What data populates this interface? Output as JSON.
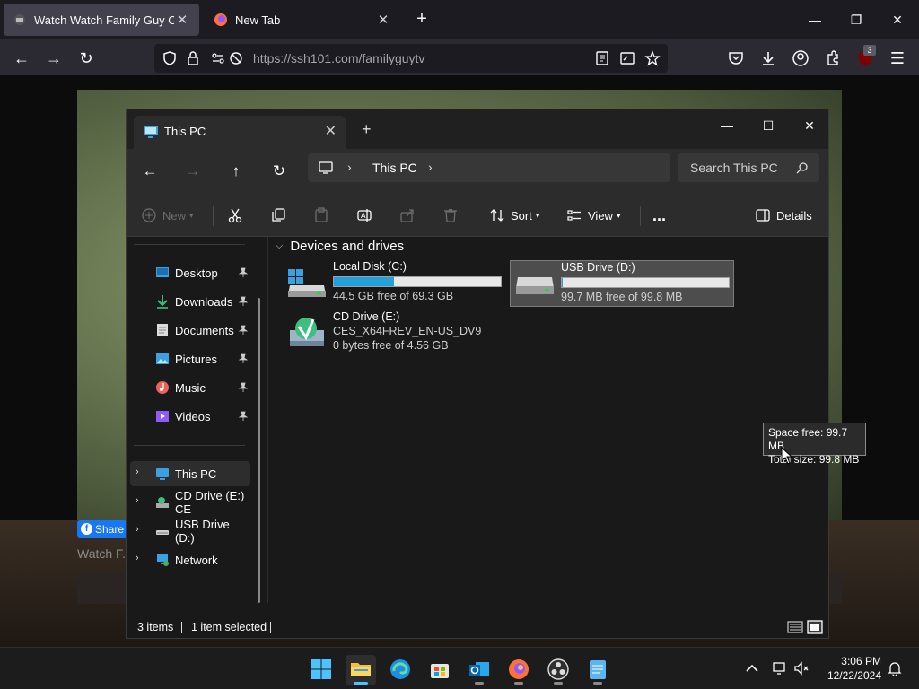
{
  "browser": {
    "tabs": [
      {
        "title": "Watch Watch Family Guy Onlin",
        "active": true
      },
      {
        "title": "New Tab",
        "active": false
      }
    ],
    "url": "https://ssh101.com/familyguytv",
    "extension_badge": "3"
  },
  "page": {
    "share_label": "Share",
    "caption": "Watch F..."
  },
  "explorer": {
    "tab_title": "This PC",
    "breadcrumb": [
      "This PC"
    ],
    "search_placeholder": "Search This PC",
    "toolbar": {
      "new": "New",
      "sort": "Sort",
      "view": "View",
      "more": "...",
      "details": "Details"
    },
    "sidebar": {
      "quick_access": [
        {
          "label": "Desktop",
          "icon": "desktop-icon"
        },
        {
          "label": "Downloads",
          "icon": "download-icon"
        },
        {
          "label": "Documents",
          "icon": "document-icon"
        },
        {
          "label": "Pictures",
          "icon": "pictures-icon"
        },
        {
          "label": "Music",
          "icon": "music-icon"
        },
        {
          "label": "Videos",
          "icon": "video-icon"
        }
      ],
      "tree": [
        {
          "label": "This PC",
          "icon": "pc-icon",
          "selected": true
        },
        {
          "label": "CD Drive (E:) CE",
          "icon": "cd-drive-icon",
          "selected": false
        },
        {
          "label": "USB Drive (D:)",
          "icon": "usb-drive-icon",
          "selected": false
        },
        {
          "label": "Network",
          "icon": "network-icon",
          "selected": false
        }
      ]
    },
    "group_title": "Devices and drives",
    "drives": [
      {
        "name": "Local Disk (C:)",
        "free_text": "44.5 GB free of 69.3 GB",
        "used_fraction": 0.36
      },
      {
        "name": "USB Drive (D:)",
        "free_text": "99.7 MB free of 99.8 MB",
        "used_fraction": 0.001
      },
      {
        "name": "CD Drive (E:)",
        "sub": "CES_X64FREV_EN-US_DV9",
        "free_text": "0 bytes free of 4.56 GB"
      }
    ],
    "tooltip": {
      "line1": "Space free: 99.7 MB",
      "line2": "Total size: 99.8 MB"
    },
    "status": {
      "items": "3 items",
      "selected": "1 item selected"
    }
  },
  "taskbar": {
    "apps": [
      "start",
      "file-explorer",
      "edge",
      "store",
      "outlook",
      "firefox",
      "obs",
      "notepad"
    ],
    "time": "3:06 PM",
    "date": "12/22/2024"
  },
  "colors": {
    "accent": "#26a0da",
    "taskbar_active": "#4cc2ff"
  }
}
